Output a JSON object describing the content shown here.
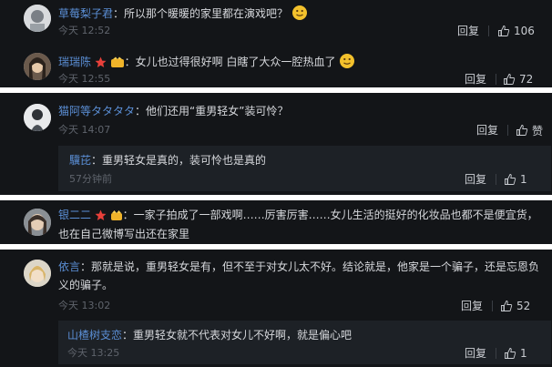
{
  "comments": [
    {
      "user": "草莓梨子君",
      "text": "：所以那个暖暖的家里都在演戏吧？",
      "time": "今天 12:52",
      "reply": "回复",
      "likes": "106"
    },
    {
      "user": "瑞瑞陈",
      "text": "：女儿也过得很好啊 白瞎了大众一腔热血了",
      "time": "今天 12:55",
      "reply": "回复",
      "likes": "72"
    },
    {
      "user": "猫阿等タタタタ",
      "text": "：他们还用“重男轻女”装可怜？",
      "time": "今天 14:07",
      "reply": "回复",
      "likes": "赞"
    },
    {
      "user": "驥芘",
      "text": "：重男轻女是真的，装可怜也是真的",
      "time": "57分钟前",
      "reply": "回复",
      "likes": "1"
    },
    {
      "user": "银二二",
      "text_line1": "：一家子拍成了一部戏啊……厉害厉害……女儿生活的挺好的化妆品也都不是便宜货，",
      "text_line2": "也在自己微博写出还在家里"
    },
    {
      "user": "依言",
      "text_line1": "：那就是说，重男轻女是有，但不至于对女儿太不好。结论就是，他家是一个骗子，还是忘恩负",
      "text_line2": "义的骗子。",
      "time": "今天 13:02",
      "reply": "回复",
      "likes": "52"
    },
    {
      "user": "山楂树支恋",
      "text": "：重男轻女就不代表对女儿不好啊，就是偏心吧",
      "time": "今天 13:25",
      "reply": "回复",
      "likes": "1"
    }
  ],
  "colors": {
    "name": "#5b8fd6",
    "bg": "#131518",
    "subbg": "#1d2126"
  }
}
